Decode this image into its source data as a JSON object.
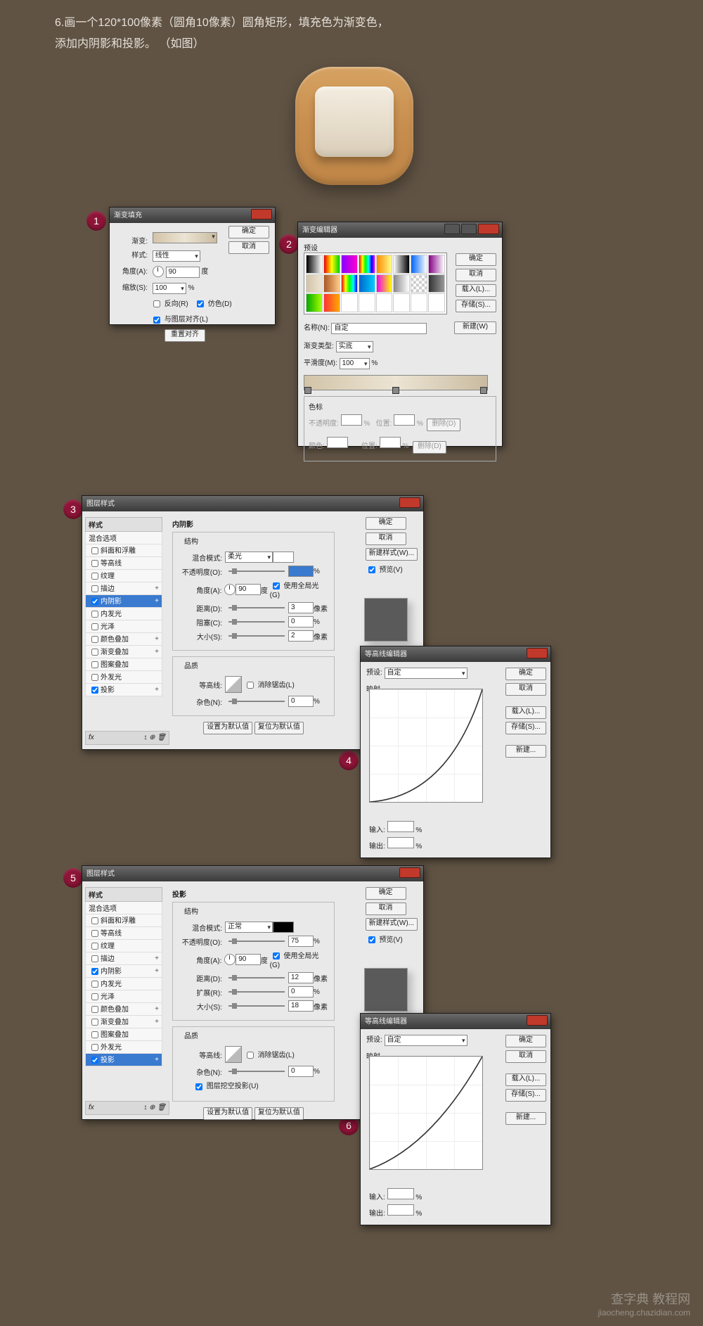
{
  "instruction": {
    "line1": "6.画一个120*100像素（圆角10像素）圆角矩形，填充色为渐变色，",
    "line2": "添加内阴影和投影。  （如图）"
  },
  "badges": {
    "n1": "1",
    "n2": "2",
    "n3": "3",
    "n4": "4",
    "n5": "5",
    "n6": "6"
  },
  "common": {
    "ok": "确定",
    "cancel": "取消",
    "load": "载入(L)...",
    "save": "存储(S)...",
    "new": "新建...",
    "new_style": "新建样式(W)...",
    "preview": "预览(V)",
    "make_default": "设置为默认值",
    "reset_default": "复位为默认值"
  },
  "p1": {
    "title": "渐变填充",
    "gradient": "渐变:",
    "style": "样式:",
    "style_val": "线性",
    "angle": "角度(A):",
    "angle_val": "90",
    "degree": "度",
    "scale": "缩放(S):",
    "scale_val": "100",
    "pct": "%",
    "reverse": "反向(R)",
    "dither": "仿色(D)",
    "align": "与图层对齐(L)",
    "reset": "重置对齐"
  },
  "p2": {
    "title": "渐变编辑器",
    "presets": "预设",
    "name": "名称(N):",
    "name_val": "自定",
    "new": "新建(W)",
    "type": "渐变类型:",
    "type_val": "实底",
    "smooth": "平滑度(M):",
    "smooth_val": "100",
    "pct": "%",
    "stops": "色标",
    "opacity": "不透明度:",
    "position": "位置:",
    "color": "颜色:",
    "delete": "删除(D)"
  },
  "p3": {
    "title": "图层样式",
    "hdr_styles": "样式",
    "blend_options": "混合选项",
    "bevel": "斜面和浮雕",
    "contour_s": "等高线",
    "texture": "纹理",
    "stroke": "描边",
    "inner_shadow": "内阴影",
    "inner_glow": "内发光",
    "satin": "光泽",
    "color_overlay": "颜色叠加",
    "gradient_overlay": "渐变叠加",
    "pattern_overlay": "图案叠加",
    "outer_glow": "外发光",
    "drop_shadow": "投影",
    "fx": "fx",
    "section_title": "内阴影",
    "structure": "结构",
    "blend_mode": "混合模式:",
    "blend_mode_val": "柔光",
    "opacity": "不透明度(O):",
    "opacity_val": " ",
    "pct": "%",
    "angle": "角度(A):",
    "angle_val": "90",
    "deg": "度",
    "global_light": "使用全局光(G)",
    "distance": "距离(D):",
    "distance_val": "3",
    "px": "像素",
    "choke": "阻塞(C):",
    "choke_val": "0",
    "size": "大小(S):",
    "size_val": "2",
    "quality": "品质",
    "contour": "等高线:",
    "anti_alias": "消除锯齿(L)",
    "noise": "杂色(N):",
    "noise_val": "0"
  },
  "p4": {
    "title": "等高线编辑器",
    "preset": "预设:",
    "preset_val": "自定",
    "mapping": "映射",
    "input": "输入:",
    "output": "输出:",
    "pct": "%"
  },
  "p5": {
    "title": "图层样式",
    "section_title": "投影",
    "structure": "结构",
    "blend_mode": "混合模式:",
    "blend_mode_val": "正常",
    "opacity": "不透明度(O):",
    "opacity_val": "75",
    "pct": "%",
    "angle": "角度(A):",
    "angle_val": "90",
    "deg": "度",
    "global_light": "使用全局光(G)",
    "distance": "距离(D):",
    "distance_val": "12",
    "px": "像素",
    "spread": "扩展(R):",
    "spread_val": "0",
    "size": "大小(S):",
    "size_val": "18",
    "quality": "品质",
    "contour": "等高线:",
    "anti_alias": "消除锯齿(L)",
    "noise": "杂色(N):",
    "noise_val": "0",
    "knockout": "图层挖空投影(U)"
  },
  "p6": {
    "title": "等高线编辑器",
    "preset": "预设:",
    "preset_val": "自定",
    "mapping": "映射",
    "input": "输入:",
    "output": "输出:",
    "pct": "%"
  },
  "watermark": {
    "cn": "查字典 教程网",
    "url": "jiaocheng.chazidian.com"
  }
}
